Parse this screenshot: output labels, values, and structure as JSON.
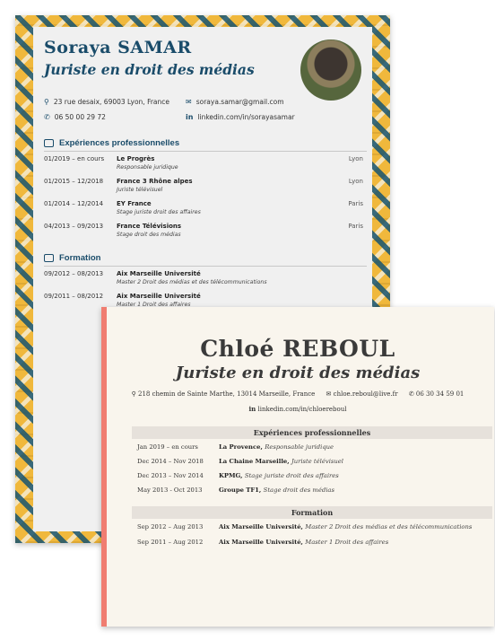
{
  "cv1": {
    "name": "Soraya SAMAR",
    "job_title": "Juriste en droit des médias",
    "address": "23 rue desaix, 69003 Lyon, France",
    "email": "soraya.samar@gmail.com",
    "phone": "06 50 00 29 72",
    "linkedin": "linkedin.com/in/sorayasamar",
    "experience_title": "Expériences professionnelles",
    "experience": [
      {
        "dates": "01/2019 – en cours",
        "org": "Le Progrès",
        "role": "Responsable juridique",
        "city": "Lyon"
      },
      {
        "dates": "01/2015 – 12/2018",
        "org": "France 3 Rhône alpes",
        "role": "Juriste télévisuel",
        "city": "Lyon"
      },
      {
        "dates": "01/2014 – 12/2014",
        "org": "EY France",
        "role": "Stage juriste droit des affaires",
        "city": "Paris"
      },
      {
        "dates": "04/2013 – 09/2013",
        "org": "France Télévisions",
        "role": "Stage droit des médias",
        "city": "Paris"
      }
    ],
    "education_title": "Formation",
    "education": [
      {
        "dates": "09/2012 – 08/2013",
        "org": "Aix Marseille Université",
        "role": "Master 2 Droit des médias et des télécommunications"
      },
      {
        "dates": "09/2011 – 08/2012",
        "org": "Aix Marseille Université",
        "role": "Master 1 Droit des affaires"
      }
    ],
    "colors": {
      "accent": "#1a4c6a",
      "tile_gold": "#f0b83c"
    }
  },
  "cv2": {
    "name": "Chloé REBOUL",
    "job_title": "Juriste en droit des médias",
    "address": "218 chemin de Sainte Marthe, 13014 Marseille, France",
    "email": "chloe.reboul@live.fr",
    "phone": "06 30 34 59 01",
    "linkedin": "linkedin.com/in/chloereboul",
    "experience_title": "Expériences professionnelles",
    "experience": [
      {
        "dates": "Jan 2019 – en cours",
        "org": "La Provence,",
        "role": "Responsable juridique"
      },
      {
        "dates": "Dec 2014 – Nov 2018",
        "org": "La Chaine Marseille,",
        "role": "Juriste télévisuel"
      },
      {
        "dates": "Dec 2013 – Nov 2014",
        "org": "KPMG,",
        "role": "Stage juriste droit des affaires"
      },
      {
        "dates": "May 2013 - Oct 2013",
        "org": "Groupe TF1,",
        "role": "Stage droit des médias"
      }
    ],
    "education_title": "Formation",
    "education": [
      {
        "dates": "Sep 2012 – Aug 2013",
        "org": "Aix Marseille Université,",
        "role": "Master 2 Droit des médias et des télécommunications"
      },
      {
        "dates": "Sep 2011 – Aug 2012",
        "org": "Aix Marseille Université,",
        "role": "Master 1 Droit des affaires"
      }
    ],
    "colors": {
      "accent": "#f07d71",
      "bar": "#e6e1db"
    }
  },
  "icons": {
    "address": "location-pin-icon",
    "email": "envelope-icon",
    "phone": "phone-icon",
    "linkedin": "linkedin-icon",
    "experience": "briefcase-icon",
    "education": "graduation-icon"
  }
}
